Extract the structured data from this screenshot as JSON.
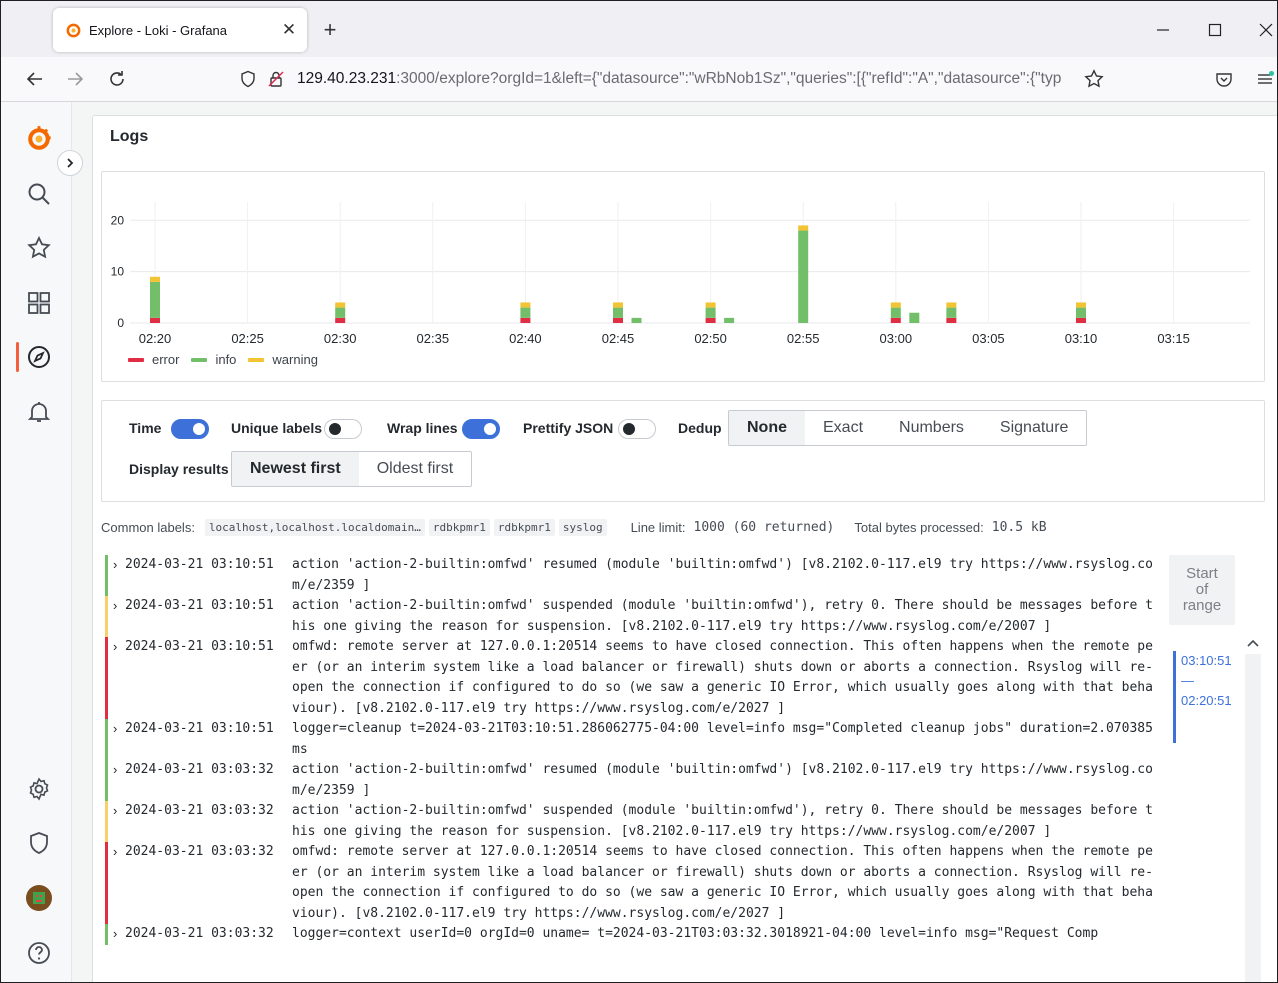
{
  "browser": {
    "tab_title": "Explore - Loki - Grafana",
    "url_main": "129.40.23.231",
    "url_rest": ":3000/explore?orgId=1&left={\"datasource\":\"wRbNob1Sz\",\"queries\":[{\"refId\":\"A\",\"datasource\":{\"typ"
  },
  "panel": {
    "title": "Logs"
  },
  "chart_data": {
    "type": "bar",
    "stacked": true,
    "x": [
      "02:20",
      "02:30",
      "02:40",
      "02:45",
      "02:46",
      "02:50",
      "02:51",
      "02:55",
      "03:00",
      "03:01",
      "03:03",
      "03:10"
    ],
    "x_ticks": [
      "02:20",
      "02:25",
      "02:30",
      "02:35",
      "02:40",
      "02:45",
      "02:50",
      "02:55",
      "03:00",
      "03:05",
      "03:10",
      "03:15"
    ],
    "y_ticks": [
      "0",
      "10",
      "20"
    ],
    "ylim": [
      0,
      22
    ],
    "series": [
      {
        "name": "error",
        "color": "#e02f44",
        "values": [
          1,
          1,
          1,
          1,
          0,
          1,
          0,
          0,
          1,
          0,
          1,
          1
        ]
      },
      {
        "name": "info",
        "color": "#73bf69",
        "values": [
          7,
          2,
          2,
          2,
          1,
          2,
          1,
          18,
          2,
          2,
          2,
          2
        ]
      },
      {
        "name": "warning",
        "color": "#f2c333",
        "values": [
          1,
          1,
          1,
          1,
          0,
          1,
          0,
          1,
          1,
          0,
          1,
          1
        ]
      }
    ],
    "legend_position": "bottom-left",
    "grid": true
  },
  "options": {
    "time_label": "Time",
    "unique_labels_label": "Unique labels",
    "wrap_lines_label": "Wrap lines",
    "prettify_json_label": "Prettify JSON",
    "dedup_label": "Dedup",
    "dedup_options": [
      "None",
      "Exact",
      "Numbers",
      "Signature"
    ],
    "display_results_label": "Display results",
    "order_options": [
      "Newest first",
      "Oldest first"
    ]
  },
  "meta": {
    "common_labels_key": "Common labels:",
    "common_labels": [
      "localhost,localhost.localdomain…",
      "rdbkpmr1",
      "rdbkpmr1",
      "syslog"
    ],
    "line_limit_key": "Line limit:",
    "line_limit_value": "1000 (60 returned)",
    "bytes_key": "Total bytes processed:",
    "bytes_value": "10.5 kB"
  },
  "logs": [
    {
      "level": "info",
      "ts": "2024-03-21 03:10:51",
      "msg": "action 'action-2-builtin:omfwd' resumed (module 'builtin:omfwd') [v8.2102.0-117.el9 try https://www.rsyslog.com/e/2359 ]"
    },
    {
      "level": "warning",
      "ts": "2024-03-21 03:10:51",
      "msg": "action 'action-2-builtin:omfwd' suspended (module 'builtin:omfwd'), retry 0. There should be messages before this one giving the reason for suspension. [v8.2102.0-117.el9 try https://www.rsyslog.com/e/2007 ]"
    },
    {
      "level": "error",
      "ts": "2024-03-21 03:10:51",
      "msg": "omfwd: remote server at 127.0.0.1:20514 seems to have closed connection. This often happens when the remote peer (or an interim system like a load balancer or firewall) shuts down or aborts a connection. Rsyslog will re-open the connection if configured to do so (we saw a generic IO Error, which usually goes along with that behaviour). [v8.2102.0-117.el9 try https://www.rsyslog.com/e/2027 ]"
    },
    {
      "level": "info",
      "ts": "2024-03-21 03:10:51",
      "msg": "logger=cleanup t=2024-03-21T03:10:51.286062775-04:00 level=info msg=\"Completed cleanup jobs\" duration=2.070385ms"
    },
    {
      "level": "info",
      "ts": "2024-03-21 03:03:32",
      "msg": "action 'action-2-builtin:omfwd' resumed (module 'builtin:omfwd') [v8.2102.0-117.el9 try https://www.rsyslog.com/e/2359 ]"
    },
    {
      "level": "warning",
      "ts": "2024-03-21 03:03:32",
      "msg": "action 'action-2-builtin:omfwd' suspended (module 'builtin:omfwd'), retry 0. There should be messages before this one giving the reason for suspension. [v8.2102.0-117.el9 try https://www.rsyslog.com/e/2007 ]"
    },
    {
      "level": "error",
      "ts": "2024-03-21 03:03:32",
      "msg": "omfwd: remote server at 127.0.0.1:20514 seems to have closed connection. This often happens when the remote peer (or an interim system like a load balancer or firewall) shuts down or aborts a connection. Rsyslog will re-open the connection if configured to do so (we saw a generic IO Error, which usually goes along with that behaviour). [v8.2102.0-117.el9 try https://www.rsyslog.com/e/2027 ]"
    },
    {
      "level": "info",
      "ts": "2024-03-21 03:03:32",
      "msg": "logger=context userId=0 orgId=0 uname= t=2024-03-21T03:03:32.3018921-04:00 level=info msg=\"Request Comp"
    }
  ],
  "range_nav": {
    "start_line1": "Start",
    "start_line2": "of",
    "start_line3": "range",
    "range_end": "03:10:51",
    "range_sep": "—",
    "range_start": "02:20:51"
  }
}
